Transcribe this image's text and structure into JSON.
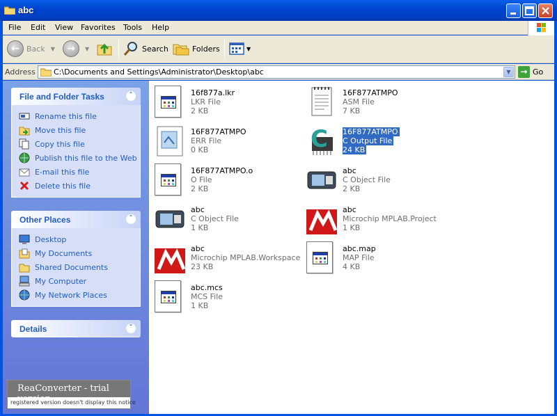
{
  "window": {
    "title": "abc"
  },
  "menu": [
    "File",
    "Edit",
    "View",
    "Favorites",
    "Tools",
    "Help"
  ],
  "toolbar": {
    "back": "Back",
    "search": "Search",
    "folders": "Folders"
  },
  "address": {
    "label": "Address",
    "path": "C:\\Documents and Settings\\Administrator\\Desktop\\abc",
    "go": "Go"
  },
  "tasks": {
    "title": "File and Folder Tasks",
    "items": [
      "Rename this file",
      "Move this file",
      "Copy this file",
      "Publish this file to the Web",
      "E-mail this file",
      "Delete this file"
    ]
  },
  "places": {
    "title": "Other Places",
    "items": [
      "Desktop",
      "My Documents",
      "Shared Documents",
      "My Computer",
      "My Network Places"
    ]
  },
  "details": {
    "title": "Details"
  },
  "files": [
    {
      "name": "16f877a.lkr",
      "type": "LKR File",
      "size": "2 KB",
      "icon": "generic-file-icon"
    },
    {
      "name": "16F877ATMPO",
      "type": "ASM File",
      "size": "7 KB",
      "icon": "notepad-file-icon"
    },
    {
      "name": "16F877ATMPO",
      "type": "ERR File",
      "size": "0 KB",
      "icon": "err-file-icon"
    },
    {
      "name": "16F877ATMPO",
      "type": "C Output File",
      "size": "24 KB",
      "icon": "c-output-chip-icon"
    },
    {
      "name": "16F877ATMPO.o",
      "type": "O File",
      "size": "2 KB",
      "icon": "generic-file-icon"
    },
    {
      "name": "abc",
      "type": "C Object File",
      "size": "2 KB",
      "icon": "c-object-icon"
    },
    {
      "name": "abc",
      "type": "C Object File",
      "size": "1 KB",
      "icon": "c-object-icon"
    },
    {
      "name": "abc",
      "type": "Microchip MPLAB.Project",
      "size": "1 KB",
      "icon": "mplab-icon"
    },
    {
      "name": "abc",
      "type": "Microchip MPLAB.Workspace",
      "size": "23 KB",
      "icon": "mplab-icon"
    },
    {
      "name": "abc.map",
      "type": "MAP File",
      "size": "4 KB",
      "icon": "generic-file-icon"
    },
    {
      "name": "abc.mcs",
      "type": "MCS File",
      "size": "1 KB",
      "icon": "generic-file-icon"
    }
  ],
  "watermark": {
    "line1": "ReaConverter - trial version",
    "line2": "registered version doesn't display this notice"
  }
}
